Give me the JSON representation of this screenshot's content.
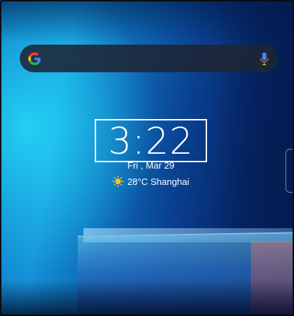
{
  "search": {
    "logo_icon": "google-g-icon",
    "mic_icon": "microphone-icon"
  },
  "clock": {
    "time": "3:22",
    "date": "Fri , Mar 29"
  },
  "weather": {
    "icon": "sun-icon",
    "text": "28°C Shanghai"
  },
  "colors": {
    "google_blue": "#4285F4",
    "google_red": "#EA4335",
    "google_yellow": "#FBBC05",
    "google_green": "#34A853",
    "sun": "#FFC21A"
  }
}
